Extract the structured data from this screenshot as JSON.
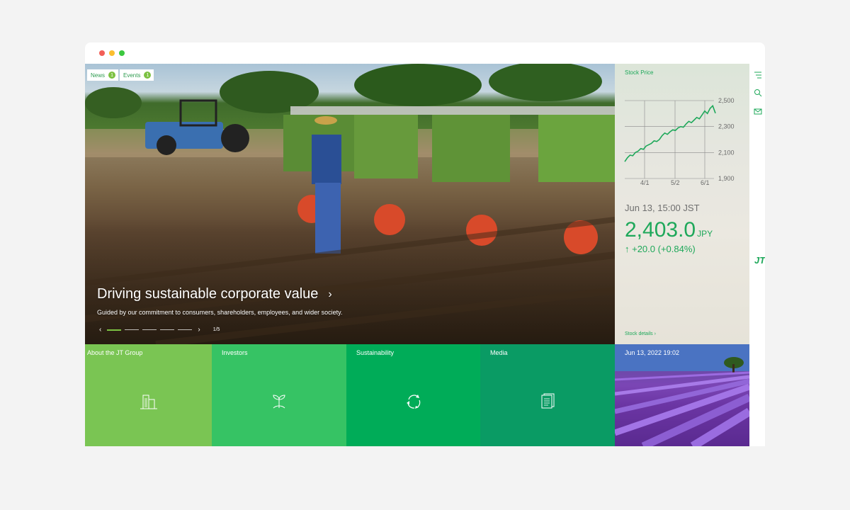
{
  "window": {
    "controls": [
      "close",
      "minimize",
      "maximize"
    ]
  },
  "hero": {
    "tags": [
      {
        "label": "News",
        "count": "1"
      },
      {
        "label": "Events",
        "count": "1"
      }
    ],
    "title": "Driving sustainable corporate value",
    "subtitle": "Guided by our commitment to consumers, shareholders, employees, and wider society.",
    "slider": {
      "page": "1/5",
      "active_index": 1
    }
  },
  "stock": {
    "label": "Stock Price",
    "time": "Jun 13, 15:00 JST",
    "price": "2,403.0",
    "unit": "JPY",
    "change": "↑ +20.0 (+0.84%)",
    "details": "Stock details ›",
    "chart_data": {
      "type": "line",
      "x_ticks": [
        "4/1",
        "5/2",
        "6/1"
      ],
      "y_ticks": [
        "2,500",
        "2,300",
        "2,100",
        "1,900"
      ],
      "ylim": [
        1900,
        2500
      ],
      "series": [
        {
          "values": [
            2030,
            2060,
            2080,
            2075,
            2100,
            2110,
            2130,
            2125,
            2150,
            2160,
            2170,
            2190,
            2185,
            2200,
            2230,
            2250,
            2240,
            2260,
            2275,
            2270,
            2290,
            2300,
            2295,
            2320,
            2340,
            2330,
            2350,
            2370,
            2360,
            2390,
            2420,
            2400,
            2440,
            2460,
            2403
          ]
        }
      ]
    }
  },
  "tiles": [
    {
      "label": "About the JT Group",
      "icon": "building-icon"
    },
    {
      "label": "Investors",
      "icon": "sprout-icon"
    },
    {
      "label": "Sustainability",
      "icon": "cycle-icon"
    },
    {
      "label": "Media",
      "icon": "document-icon"
    }
  ],
  "lavender": {
    "date": "Jun 13, 2022 19:02"
  },
  "rail": {
    "icons": [
      "menu-icon",
      "search-icon",
      "mail-icon"
    ],
    "logo": "JT"
  },
  "colors": {
    "accent": "#1ea85a",
    "tile1": "#7ac553",
    "tile2": "#36c364",
    "tile3": "#00ac58",
    "tile4": "#0a9b64"
  }
}
